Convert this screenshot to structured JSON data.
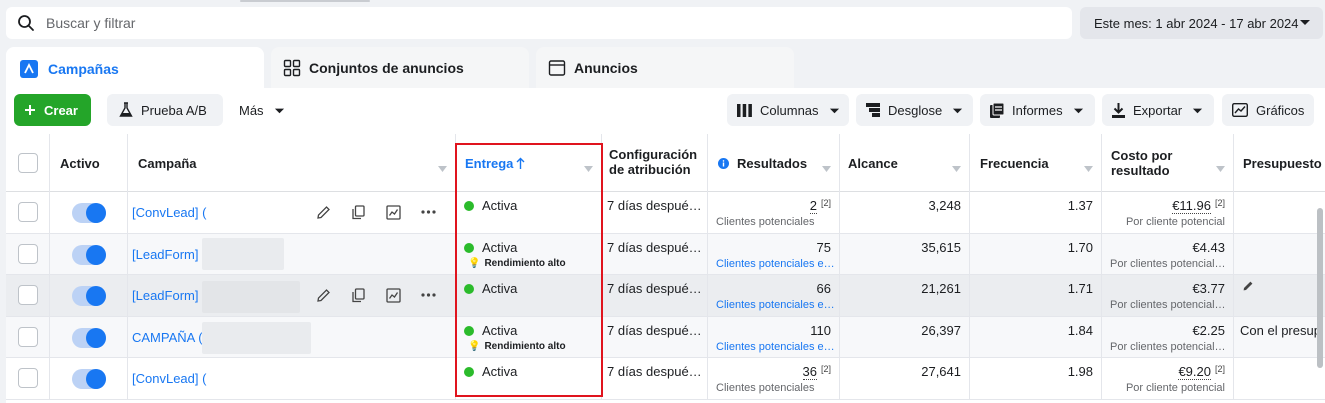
{
  "search": {
    "placeholder": "Buscar y filtrar"
  },
  "date_range": {
    "label": "Este mes: 1 abr 2024 - 17 abr 2024"
  },
  "tabs": [
    {
      "label": "Campañas",
      "active": true
    },
    {
      "label": "Conjuntos de anuncios",
      "active": false
    },
    {
      "label": "Anuncios",
      "active": false
    }
  ],
  "toolbar": {
    "create": "Crear",
    "ab_test": "Prueba A/B",
    "more": "Más",
    "columns": "Columnas",
    "breakdown": "Desglose",
    "reports": "Informes",
    "export": "Exportar",
    "charts": "Gráficos"
  },
  "columns": {
    "activo": "Activo",
    "campana": "Campaña",
    "entrega": "Entrega",
    "config_1": "Configuración",
    "config_2": "de atribución",
    "resultados": "Resultados",
    "alcance": "Alcance",
    "frecuencia": "Frecuencia",
    "costo_1": "Costo por",
    "costo_2": "resultado",
    "presupuesto": "Presupuesto"
  },
  "rows": [
    {
      "campaign": "[ConvLead] (",
      "delivery": "Activa",
      "delivery_note": "",
      "attribution": "7 días despué…",
      "results": "2",
      "results_sup": "[2]",
      "results_sub": "Clientes potenciales",
      "results_sub_link": false,
      "reach": "3,248",
      "frequency": "1.37",
      "cost": "€11.96",
      "cost_sup": "[2]",
      "cost_sub": "Por cliente potencial",
      "budget": ""
    },
    {
      "campaign": "[LeadForm] F",
      "delivery": "Activa",
      "delivery_note": "Rendimiento alto",
      "attribution": "7 días despué…",
      "results": "75",
      "results_sup": "",
      "results_sub": "Clientes potenciales e…",
      "results_sub_link": true,
      "reach": "35,615",
      "frequency": "1.70",
      "cost": "€4.43",
      "cost_sup": "",
      "cost_sub": "Por clientes potencial…",
      "budget": ""
    },
    {
      "campaign": "[LeadForm] (",
      "delivery": "Activa",
      "delivery_note": "",
      "attribution": "7 días despué…",
      "results": "66",
      "results_sup": "",
      "results_sub": "Clientes potenciales e…",
      "results_sub_link": true,
      "reach": "21,261",
      "frequency": "1.71",
      "cost": "€3.77",
      "cost_sup": "",
      "cost_sub": "Por clientes potencial…",
      "budget": ""
    },
    {
      "campaign": "CAMPAÑA (N",
      "delivery": "Activa",
      "delivery_note": "Rendimiento alto",
      "attribution": "7 días despué…",
      "results": "110",
      "results_sup": "",
      "results_sub": "Clientes potenciales e…",
      "results_sub_link": true,
      "reach": "26,397",
      "frequency": "1.84",
      "cost": "€2.25",
      "cost_sup": "",
      "cost_sub": "Por clientes potencial…",
      "budget": "Con el presup"
    },
    {
      "campaign": "[ConvLead] (",
      "delivery": "Activa",
      "delivery_note": "",
      "attribution": "7 días despué…",
      "results": "36",
      "results_sup": "[2]",
      "results_sub": "Clientes potenciales",
      "results_sub_link": false,
      "reach": "27,641",
      "frequency": "1.98",
      "cost": "€9.20",
      "cost_sup": "[2]",
      "cost_sub": "Por cliente potencial",
      "budget": ""
    }
  ],
  "colors": {
    "accent": "#1877f2",
    "active_dot": "#2bbb2b",
    "highlight_box": "#e0141e",
    "create_button": "#24a529"
  }
}
